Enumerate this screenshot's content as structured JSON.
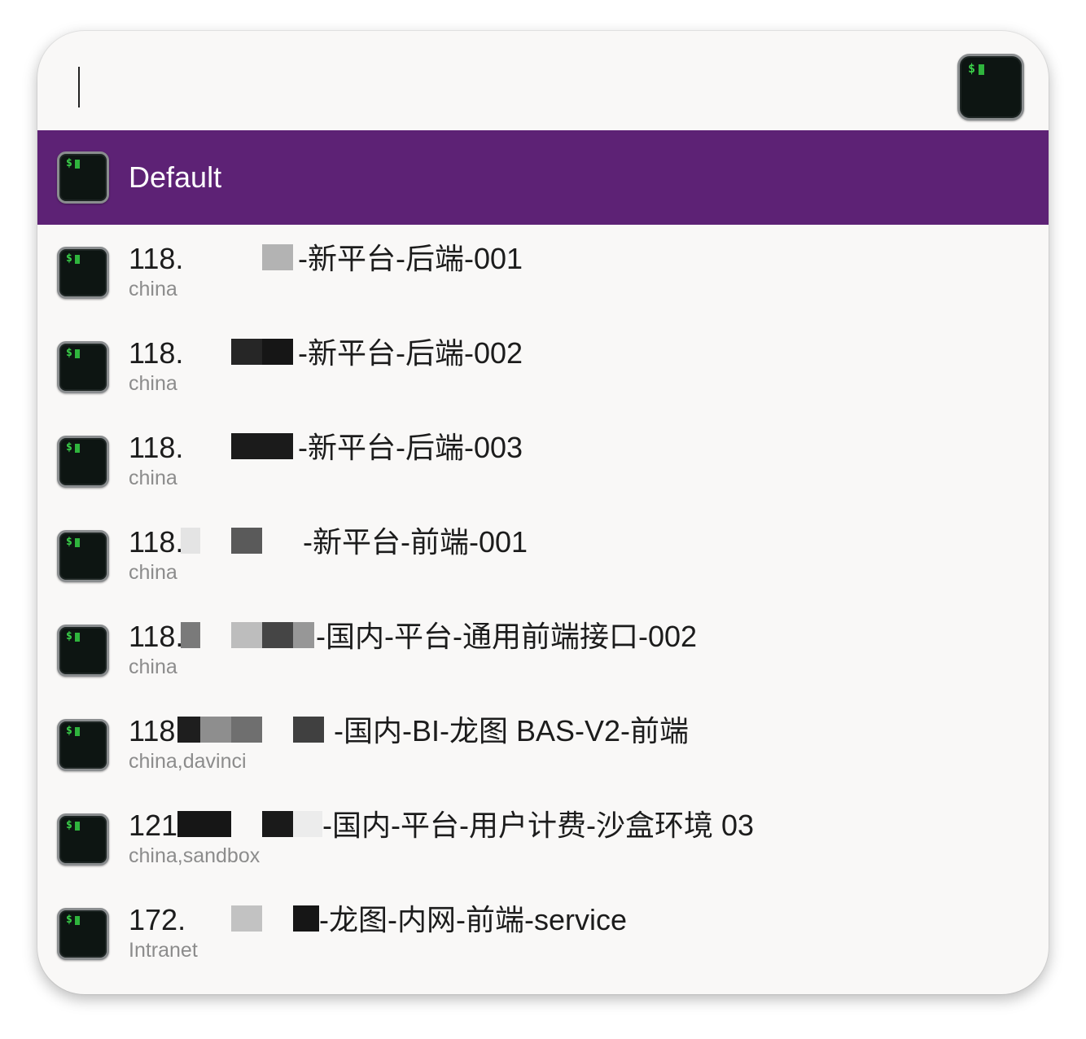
{
  "search": {
    "value": "",
    "placeholder": ""
  },
  "icons": {
    "terminal": "terminal-icon",
    "prompt_glyph": "$"
  },
  "colors": {
    "selected_bg": "#5d2275",
    "selected_text": "#ffffff",
    "panel_bg": "#f9f8f7",
    "title_text": "#1c1c1c",
    "subtitle_text": "#8c8c8c",
    "terminal_green": "#3bd14a"
  },
  "selected": {
    "title": "Default"
  },
  "results": [
    {
      "prefix": "118.",
      "suffix": "-新平台-后端-001",
      "subtitle": "china"
    },
    {
      "prefix": "118.",
      "suffix": "-新平台-后端-002",
      "subtitle": "china"
    },
    {
      "prefix": "118.",
      "suffix": "-新平台-后端-003",
      "subtitle": "china"
    },
    {
      "prefix": "118.",
      "suffix": "-新平台-前端-001",
      "subtitle": "china"
    },
    {
      "prefix": "118.",
      "suffix": "-国内-平台-通用前端接口-002",
      "subtitle": "china"
    },
    {
      "prefix": "118.",
      "suffix": "-国内-BI-龙图 BAS-V2-前端",
      "subtitle": "china,davinci"
    },
    {
      "prefix": "121.",
      "suffix": "-国内-平台-用户计费-沙盒环境 03",
      "subtitle": "china,sandbox"
    },
    {
      "prefix": "172.",
      "suffix": "-龙图-内网-前端-service",
      "subtitle": "Intranet"
    }
  ]
}
